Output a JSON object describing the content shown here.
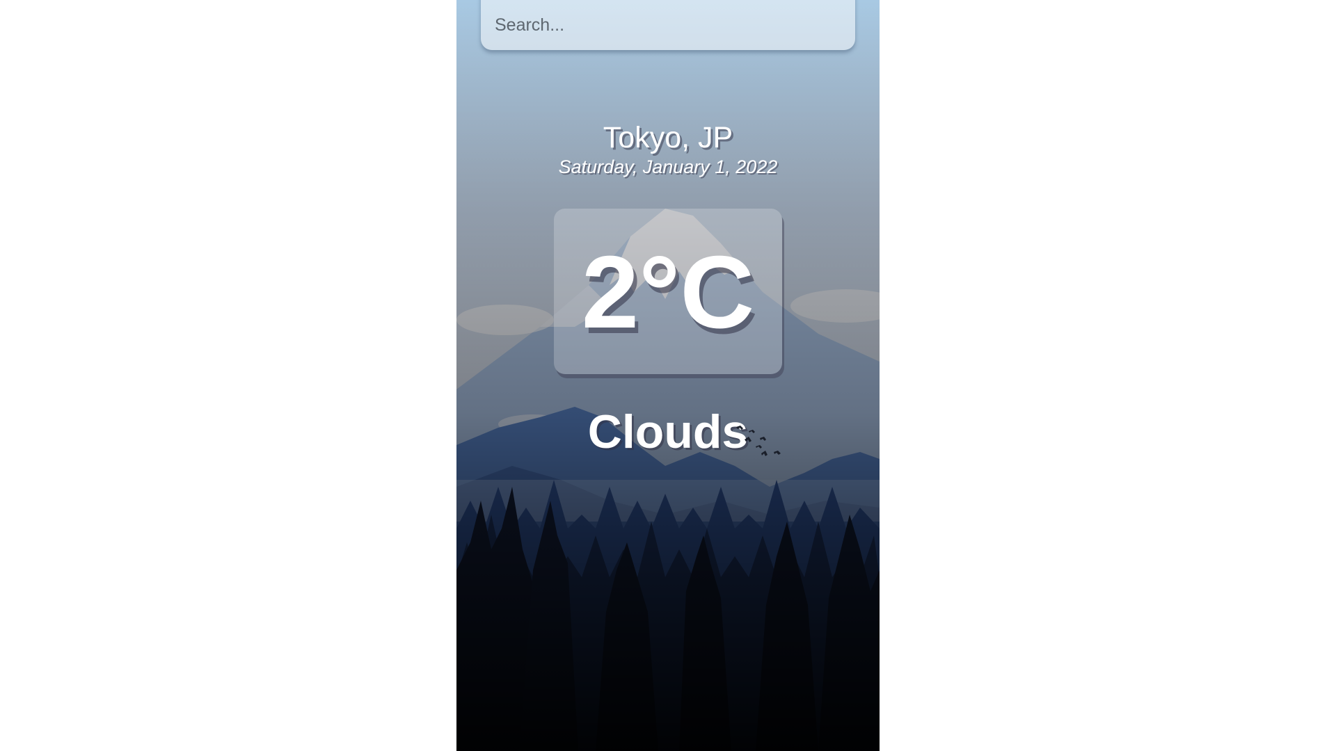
{
  "search": {
    "placeholder": "Search...",
    "value": ""
  },
  "location": {
    "city": "Tokyo, JP",
    "date": "Saturday, January 1, 2022"
  },
  "weather": {
    "temperature": "2°C",
    "condition": "Clouds"
  },
  "background": {
    "description_icon": "mountain-forest-landscape",
    "sky_top": "#a9c7df",
    "sky_mid": "#b7bfce",
    "forest_dark": "#0d1424"
  }
}
